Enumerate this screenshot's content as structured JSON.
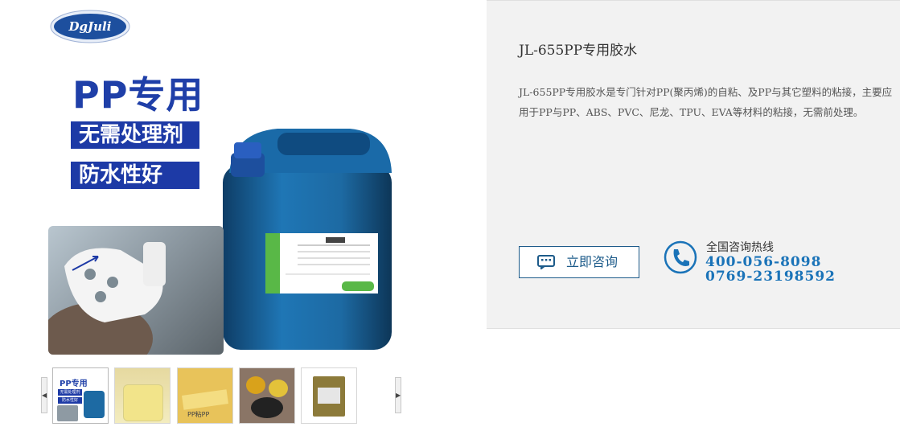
{
  "brand": {
    "logo_text": "DgJuli"
  },
  "main_image": {
    "headline": "PP专用",
    "badge_1": "无需处理剂",
    "badge_2": "防水性好"
  },
  "thumbnails": [
    {
      "label": "PP专用",
      "lines": [
        "无需处理剂",
        "防水性好"
      ]
    },
    {
      "label": ""
    },
    {
      "label": "PP粘PP"
    },
    {
      "label": ""
    },
    {
      "label": ""
    }
  ],
  "nav": {
    "prev_icon": "arrow-left-icon",
    "next_icon": "arrow-right-icon"
  },
  "product": {
    "title": "JL-655PP专用胶水",
    "description": "JL-655PP专用胶水是专门针对PP(聚丙烯)的自粘、及PP与其它塑料的粘接，主要应用于PP与PP、ABS、PVC、尼龙、TPU、EVA等材料的粘接，无需前处理。"
  },
  "contact": {
    "consult_label": "立即咨询",
    "hotline_label": "全国咨询热线",
    "phone_1": "400-056-8098",
    "phone_2": "0769-23198592",
    "accent_color": "#1a73b8"
  }
}
